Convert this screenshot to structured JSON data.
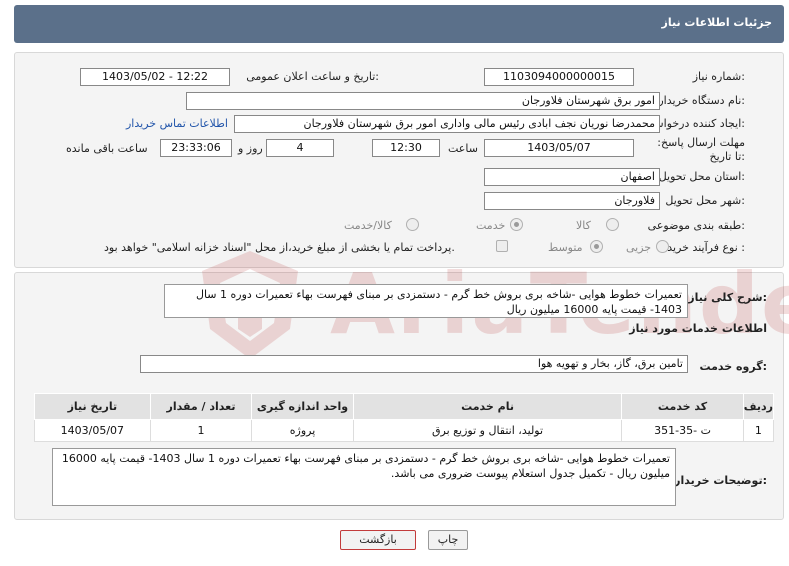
{
  "header": {
    "title": "جزئیات اطلاعات نیاز"
  },
  "form": {
    "need_number_label": "شماره نیاز:",
    "need_number": "1103094000000015",
    "announce_label": "تاریخ و ساعت اعلان عمومی:",
    "announce_value": "1403/05/02 - 12:22",
    "buyer_org_label": "نام دستگاه خریدار:",
    "buyer_org": "امور برق شهرستان فلاورجان",
    "creator_label": "ایجاد کننده درخواست:",
    "creator": "محمدرضا نوریان نجف ابادی رئیس مالی واداری  امور برق شهرستان فلاورجان",
    "contact_link": "اطلاعات تماس خریدار",
    "deadline_label": "مهلت ارسال پاسخ: تا تاریخ:",
    "deadline_date": "1403/05/07",
    "time_label": "ساعت",
    "deadline_time": "12:30",
    "days_value": "4",
    "days_label": "روز و",
    "remaining_time": "23:33:06",
    "remaining_label": "ساعت باقی مانده",
    "province_label": "استان محل تحویل:",
    "province": "اصفهان",
    "city_label": "شهر محل تحویل:",
    "city": "فلاورجان",
    "category_label": "طبقه بندی موضوعی:",
    "category_options": [
      "کالا",
      "خدمت",
      "کالا/خدمت"
    ],
    "category_selected": "خدمت",
    "process_label": "نوع فرآیند خرید :",
    "process_options": [
      "جزیی",
      "متوسط"
    ],
    "process_selected": "متوسط",
    "payment_note": "پرداخت تمام یا بخشی از مبلغ خرید،از محل \"اسناد خزانه اسلامی\" خواهد بود."
  },
  "details": {
    "summary_label": "شرح کلی نیاز:",
    "summary": "تعمیرات خطوط هوایی -شاخه بری بروش خط گرم - دستمزدی بر مبنای فهرست بهاء تعمیرات دوره 1 سال 1403- قیمت پایه 16000 میلیون ریال",
    "services_title": "اطلاعات خدمات مورد نیاز",
    "service_group_label": "گروه خدمت:",
    "service_group": "تامین برق، گاز، بخار و تهویه هوا",
    "table": {
      "headers": [
        "ردیف",
        "کد خدمت",
        "نام خدمت",
        "واحد اندازه گیری",
        "تعداد / مقدار",
        "تاریخ نیاز"
      ],
      "rows": [
        [
          "1",
          "ت -35-351",
          "تولید، انتقال و توزیع برق",
          "پروژه",
          "1",
          "1403/05/07"
        ]
      ]
    },
    "buyer_notes_label": "توضیحات خریدار:",
    "buyer_notes": "تعمیرات خطوط هوایی -شاخه بری بروش خط گرم - دستمزدی بر مبنای فهرست بهاء تعمیرات دوره 1 سال 1403- قیمت پایه 16000 میلیون ریال - تکمیل جدول استعلام پیوست ضروری می باشد."
  },
  "buttons": {
    "print": "چاپ",
    "back": "بازگشت"
  },
  "watermark": {
    "text": "AriaTender.net"
  },
  "colors": {
    "header": "#5b708a",
    "back_border": "#c23b3b",
    "watermark": "#b52a2a"
  }
}
